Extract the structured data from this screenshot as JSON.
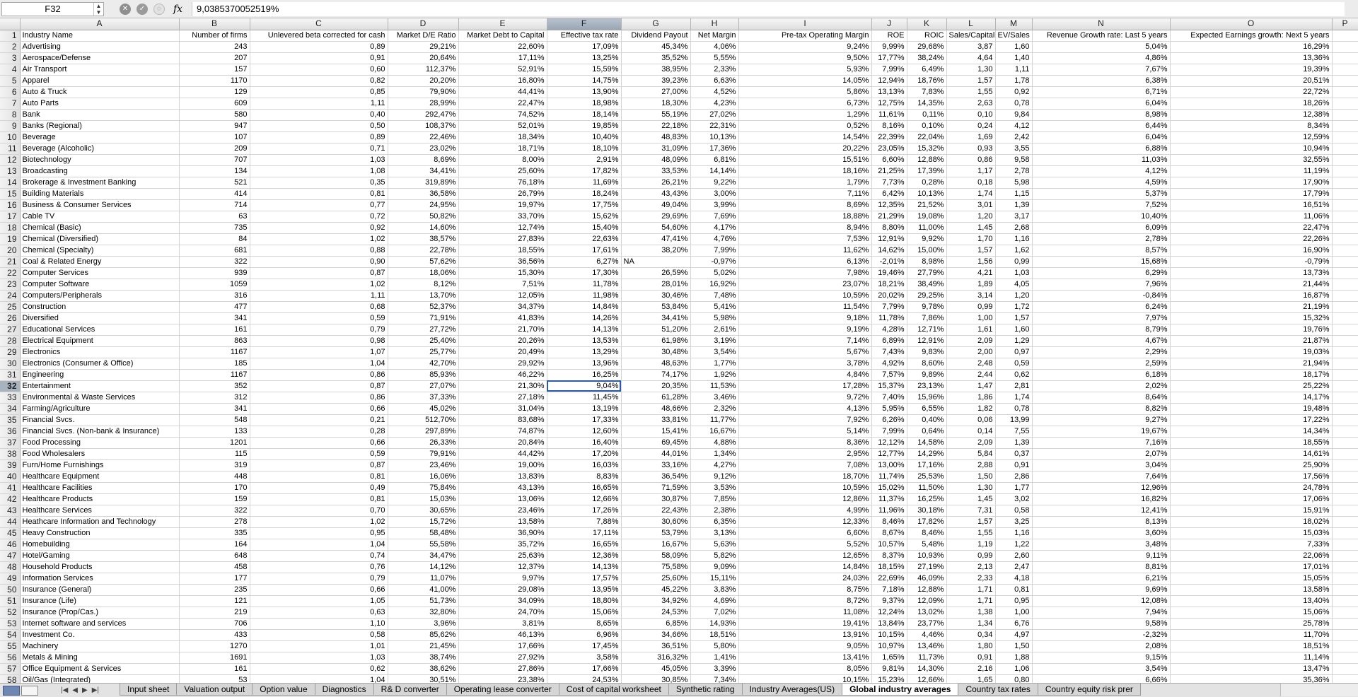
{
  "formula_bar": {
    "name_box": "F32",
    "formula": "9,0385370052519%"
  },
  "columns": [
    "A",
    "B",
    "C",
    "D",
    "E",
    "F",
    "G",
    "H",
    "I",
    "J",
    "K",
    "L",
    "M",
    "N",
    "O",
    "P"
  ],
  "selected_column": "F",
  "selected_row": 32,
  "header_row": [
    "Industry Name",
    "Number of firms",
    "Unlevered beta corrected for cash",
    "Market D/E Ratio",
    "Market Debt to Capital",
    "Effective tax rate",
    "Dividend Payout",
    "Net Margin",
    "Pre-tax Operating Margin",
    "ROE",
    "ROIC",
    "Sales/Capital",
    "EV/Sales",
    "Revenue Growth rate: Last 5 years",
    "Expected Earnings growth: Next 5 years",
    ""
  ],
  "rows": [
    [
      "Advertising",
      "243",
      "0,89",
      "29,21%",
      "22,60%",
      "17,09%",
      "45,34%",
      "4,06%",
      "9,24%",
      "9,99%",
      "29,68%",
      "3,87",
      "1,60",
      "5,04%",
      "16,29%"
    ],
    [
      "Aerospace/Defense",
      "207",
      "0,91",
      "20,64%",
      "17,11%",
      "13,25%",
      "35,52%",
      "5,55%",
      "9,50%",
      "17,77%",
      "38,24%",
      "4,64",
      "1,40",
      "4,86%",
      "13,36%"
    ],
    [
      "Air Transport",
      "157",
      "0,60",
      "112,37%",
      "52,91%",
      "15,59%",
      "38,95%",
      "2,33%",
      "5,93%",
      "7,99%",
      "6,49%",
      "1,30",
      "1,11",
      "7,67%",
      "19,39%"
    ],
    [
      "Apparel",
      "1170",
      "0,82",
      "20,20%",
      "16,80%",
      "14,75%",
      "39,23%",
      "6,63%",
      "14,05%",
      "12,94%",
      "18,76%",
      "1,57",
      "1,78",
      "6,38%",
      "20,51%"
    ],
    [
      "Auto & Truck",
      "129",
      "0,85",
      "79,90%",
      "44,41%",
      "13,90%",
      "27,00%",
      "4,52%",
      "5,86%",
      "13,13%",
      "7,83%",
      "1,55",
      "0,92",
      "6,71%",
      "22,72%"
    ],
    [
      "Auto Parts",
      "609",
      "1,11",
      "28,99%",
      "22,47%",
      "18,98%",
      "18,30%",
      "4,23%",
      "6,73%",
      "12,75%",
      "14,35%",
      "2,63",
      "0,78",
      "6,04%",
      "18,26%"
    ],
    [
      "Bank",
      "580",
      "0,40",
      "292,47%",
      "74,52%",
      "18,14%",
      "55,19%",
      "27,02%",
      "1,29%",
      "11,61%",
      "0,11%",
      "0,10",
      "9,84",
      "8,98%",
      "12,38%"
    ],
    [
      "Banks (Regional)",
      "947",
      "0,50",
      "108,37%",
      "52,01%",
      "19,85%",
      "22,18%",
      "22,31%",
      "0,52%",
      "8,16%",
      "0,10%",
      "0,24",
      "4,12",
      "6,44%",
      "8,34%"
    ],
    [
      "Beverage",
      "107",
      "0,89",
      "22,46%",
      "18,34%",
      "10,40%",
      "48,83%",
      "10,13%",
      "14,54%",
      "22,39%",
      "22,04%",
      "1,69",
      "2,42",
      "6,04%",
      "12,59%"
    ],
    [
      "Beverage (Alcoholic)",
      "209",
      "0,71",
      "23,02%",
      "18,71%",
      "18,10%",
      "31,09%",
      "17,36%",
      "20,22%",
      "23,05%",
      "15,32%",
      "0,93",
      "3,55",
      "6,88%",
      "10,94%"
    ],
    [
      "Biotechnology",
      "707",
      "1,03",
      "8,69%",
      "8,00%",
      "2,91%",
      "48,09%",
      "6,81%",
      "15,51%",
      "6,60%",
      "12,88%",
      "0,86",
      "9,58",
      "11,03%",
      "32,55%"
    ],
    [
      "Broadcasting",
      "134",
      "1,08",
      "34,41%",
      "25,60%",
      "17,82%",
      "33,53%",
      "14,14%",
      "18,16%",
      "21,25%",
      "17,39%",
      "1,17",
      "2,78",
      "4,12%",
      "11,19%"
    ],
    [
      "Brokerage & Investment Banking",
      "521",
      "0,35",
      "319,89%",
      "76,18%",
      "11,69%",
      "26,21%",
      "9,22%",
      "1,79%",
      "7,73%",
      "0,28%",
      "0,18",
      "5,98",
      "4,59%",
      "17,90%"
    ],
    [
      "Building Materials",
      "414",
      "0,81",
      "36,58%",
      "26,79%",
      "18,24%",
      "43,43%",
      "3,00%",
      "7,11%",
      "6,42%",
      "10,13%",
      "1,74",
      "1,15",
      "5,37%",
      "17,79%"
    ],
    [
      "Business & Consumer Services",
      "714",
      "0,77",
      "24,95%",
      "19,97%",
      "17,75%",
      "49,04%",
      "3,99%",
      "8,69%",
      "12,35%",
      "21,52%",
      "3,01",
      "1,39",
      "7,52%",
      "16,51%"
    ],
    [
      "Cable TV",
      "63",
      "0,72",
      "50,82%",
      "33,70%",
      "15,62%",
      "29,69%",
      "7,69%",
      "18,88%",
      "21,29%",
      "19,08%",
      "1,20",
      "3,17",
      "10,40%",
      "11,06%"
    ],
    [
      "Chemical (Basic)",
      "735",
      "0,92",
      "14,60%",
      "12,74%",
      "15,40%",
      "54,60%",
      "4,17%",
      "8,94%",
      "8,80%",
      "11,00%",
      "1,45",
      "2,68",
      "6,09%",
      "22,47%"
    ],
    [
      "Chemical (Diversified)",
      "84",
      "1,02",
      "38,57%",
      "27,83%",
      "22,63%",
      "47,41%",
      "4,76%",
      "7,53%",
      "12,91%",
      "9,92%",
      "1,70",
      "1,16",
      "2,78%",
      "22,26%"
    ],
    [
      "Chemical (Specialty)",
      "681",
      "0,88",
      "22,78%",
      "18,55%",
      "17,61%",
      "38,20%",
      "7,99%",
      "11,62%",
      "14,62%",
      "15,00%",
      "1,57",
      "1,62",
      "8,57%",
      "16,90%"
    ],
    [
      "Coal & Related Energy",
      "322",
      "0,90",
      "57,62%",
      "36,56%",
      "6,27%",
      "NA",
      "-0,97%",
      "6,13%",
      "-2,01%",
      "8,98%",
      "1,56",
      "0,99",
      "15,68%",
      "-0,79%"
    ],
    [
      "Computer Services",
      "939",
      "0,87",
      "18,06%",
      "15,30%",
      "17,30%",
      "26,59%",
      "5,02%",
      "7,98%",
      "19,46%",
      "27,79%",
      "4,21",
      "1,03",
      "6,29%",
      "13,73%"
    ],
    [
      "Computer Software",
      "1059",
      "1,02",
      "8,12%",
      "7,51%",
      "11,78%",
      "28,01%",
      "16,92%",
      "23,07%",
      "18,21%",
      "38,49%",
      "1,89",
      "4,05",
      "7,96%",
      "21,44%"
    ],
    [
      "Computers/Peripherals",
      "316",
      "1,11",
      "13,70%",
      "12,05%",
      "11,98%",
      "30,46%",
      "7,48%",
      "10,59%",
      "20,02%",
      "29,25%",
      "3,14",
      "1,20",
      "-0,84%",
      "16,87%"
    ],
    [
      "Construction",
      "477",
      "0,68",
      "52,37%",
      "34,37%",
      "14,84%",
      "53,84%",
      "5,41%",
      "11,54%",
      "7,79%",
      "9,78%",
      "0,99",
      "1,72",
      "6,24%",
      "21,19%"
    ],
    [
      "Diversified",
      "341",
      "0,59",
      "71,91%",
      "41,83%",
      "14,26%",
      "34,41%",
      "5,98%",
      "9,18%",
      "11,78%",
      "7,86%",
      "1,00",
      "1,57",
      "7,97%",
      "15,32%"
    ],
    [
      "Educational Services",
      "161",
      "0,79",
      "27,72%",
      "21,70%",
      "14,13%",
      "51,20%",
      "2,61%",
      "9,19%",
      "4,28%",
      "12,71%",
      "1,61",
      "1,60",
      "8,79%",
      "19,76%"
    ],
    [
      "Electrical Equipment",
      "863",
      "0,98",
      "25,40%",
      "20,26%",
      "13,53%",
      "61,98%",
      "3,19%",
      "7,14%",
      "6,89%",
      "12,91%",
      "2,09",
      "1,29",
      "4,67%",
      "21,87%"
    ],
    [
      "Electronics",
      "1167",
      "1,07",
      "25,77%",
      "20,49%",
      "13,29%",
      "30,48%",
      "3,54%",
      "5,67%",
      "7,43%",
      "9,83%",
      "2,00",
      "0,97",
      "2,29%",
      "19,03%"
    ],
    [
      "Electronics (Consumer & Office)",
      "185",
      "1,04",
      "42,70%",
      "29,92%",
      "13,96%",
      "48,63%",
      "1,77%",
      "3,78%",
      "4,92%",
      "8,60%",
      "2,48",
      "0,59",
      "2,59%",
      "21,94%"
    ],
    [
      "Engineering",
      "1167",
      "0,86",
      "85,93%",
      "46,22%",
      "16,25%",
      "74,17%",
      "1,92%",
      "4,84%",
      "7,57%",
      "9,89%",
      "2,44",
      "0,62",
      "6,18%",
      "18,17%"
    ],
    [
      "Entertainment",
      "352",
      "0,87",
      "27,07%",
      "21,30%",
      "9,04%",
      "20,35%",
      "11,53%",
      "17,28%",
      "15,37%",
      "23,13%",
      "1,47",
      "2,81",
      "2,02%",
      "25,22%"
    ],
    [
      "Environmental & Waste Services",
      "312",
      "0,86",
      "37,33%",
      "27,18%",
      "11,45%",
      "61,28%",
      "3,46%",
      "9,72%",
      "7,40%",
      "15,96%",
      "1,86",
      "1,74",
      "8,64%",
      "14,17%"
    ],
    [
      "Farming/Agriculture",
      "341",
      "0,66",
      "45,02%",
      "31,04%",
      "13,19%",
      "48,66%",
      "2,32%",
      "4,13%",
      "5,95%",
      "6,55%",
      "1,82",
      "0,78",
      "8,82%",
      "19,48%"
    ],
    [
      "Financial Svcs.",
      "548",
      "0,21",
      "512,70%",
      "83,68%",
      "17,33%",
      "33,81%",
      "11,77%",
      "7,92%",
      "6,26%",
      "0,40%",
      "0,06",
      "13,99",
      "9,27%",
      "17,22%"
    ],
    [
      "Financial Svcs. (Non-bank & Insurance)",
      "133",
      "0,28",
      "297,89%",
      "74,87%",
      "12,60%",
      "15,41%",
      "16,67%",
      "5,14%",
      "7,99%",
      "0,64%",
      "0,14",
      "7,55",
      "19,67%",
      "14,34%"
    ],
    [
      "Food Processing",
      "1201",
      "0,66",
      "26,33%",
      "20,84%",
      "16,40%",
      "69,45%",
      "4,88%",
      "8,36%",
      "12,12%",
      "14,58%",
      "2,09",
      "1,39",
      "7,16%",
      "18,55%"
    ],
    [
      "Food Wholesalers",
      "115",
      "0,59",
      "79,91%",
      "44,42%",
      "17,20%",
      "44,01%",
      "1,34%",
      "2,95%",
      "12,77%",
      "14,29%",
      "5,84",
      "0,37",
      "2,07%",
      "14,61%"
    ],
    [
      "Furn/Home Furnishings",
      "319",
      "0,87",
      "23,46%",
      "19,00%",
      "16,03%",
      "33,16%",
      "4,27%",
      "7,08%",
      "13,00%",
      "17,16%",
      "2,88",
      "0,91",
      "3,04%",
      "25,90%"
    ],
    [
      "Healthcare Equipment",
      "448",
      "0,81",
      "16,06%",
      "13,83%",
      "8,83%",
      "36,54%",
      "9,12%",
      "18,70%",
      "11,74%",
      "25,53%",
      "1,50",
      "2,86",
      "7,64%",
      "17,56%"
    ],
    [
      "Healthcare Facilities",
      "170",
      "0,49",
      "75,84%",
      "43,13%",
      "16,65%",
      "71,59%",
      "3,53%",
      "10,59%",
      "15,02%",
      "11,50%",
      "1,30",
      "1,77",
      "12,96%",
      "24,78%"
    ],
    [
      "Healthcare Products",
      "159",
      "0,81",
      "15,03%",
      "13,06%",
      "12,66%",
      "30,87%",
      "7,85%",
      "12,86%",
      "11,37%",
      "16,25%",
      "1,45",
      "3,02",
      "16,82%",
      "17,06%"
    ],
    [
      "Healthcare Services",
      "322",
      "0,70",
      "30,65%",
      "23,46%",
      "17,26%",
      "22,43%",
      "2,38%",
      "4,99%",
      "11,96%",
      "30,18%",
      "7,31",
      "0,58",
      "12,41%",
      "15,91%"
    ],
    [
      "Heathcare Information and Technology",
      "278",
      "1,02",
      "15,72%",
      "13,58%",
      "7,88%",
      "30,60%",
      "6,35%",
      "12,33%",
      "8,46%",
      "17,82%",
      "1,57",
      "3,25",
      "8,13%",
      "18,02%"
    ],
    [
      "Heavy Construction",
      "335",
      "0,95",
      "58,48%",
      "36,90%",
      "17,11%",
      "53,79%",
      "3,13%",
      "6,60%",
      "8,67%",
      "8,46%",
      "1,55",
      "1,16",
      "3,60%",
      "15,03%"
    ],
    [
      "Homebuilding",
      "164",
      "1,04",
      "55,58%",
      "35,72%",
      "16,65%",
      "16,67%",
      "5,63%",
      "5,52%",
      "10,57%",
      "5,48%",
      "1,19",
      "1,22",
      "3,48%",
      "7,33%"
    ],
    [
      "Hotel/Gaming",
      "648",
      "0,74",
      "34,47%",
      "25,63%",
      "12,36%",
      "58,09%",
      "5,82%",
      "12,65%",
      "8,37%",
      "10,93%",
      "0,99",
      "2,60",
      "9,11%",
      "22,06%"
    ],
    [
      "Household Products",
      "458",
      "0,76",
      "14,12%",
      "12,37%",
      "14,13%",
      "75,58%",
      "9,09%",
      "14,84%",
      "18,15%",
      "27,19%",
      "2,13",
      "2,47",
      "8,81%",
      "17,01%"
    ],
    [
      "Information Services",
      "177",
      "0,79",
      "11,07%",
      "9,97%",
      "17,57%",
      "25,60%",
      "15,11%",
      "24,03%",
      "22,69%",
      "46,09%",
      "2,33",
      "4,18",
      "6,21%",
      "15,05%"
    ],
    [
      "Insurance (General)",
      "235",
      "0,66",
      "41,00%",
      "29,08%",
      "13,95%",
      "45,22%",
      "3,83%",
      "8,75%",
      "7,18%",
      "12,88%",
      "1,71",
      "0,81",
      "9,69%",
      "13,58%"
    ],
    [
      "Insurance (Life)",
      "121",
      "1,05",
      "51,73%",
      "34,09%",
      "18,80%",
      "34,92%",
      "4,69%",
      "8,72%",
      "9,37%",
      "12,09%",
      "1,71",
      "0,95",
      "12,08%",
      "13,40%"
    ],
    [
      "Insurance (Prop/Cas.)",
      "219",
      "0,63",
      "32,80%",
      "24,70%",
      "15,06%",
      "24,53%",
      "7,02%",
      "11,08%",
      "12,24%",
      "13,02%",
      "1,38",
      "1,00",
      "7,94%",
      "15,06%"
    ],
    [
      "Internet software and services",
      "706",
      "1,10",
      "3,96%",
      "3,81%",
      "8,65%",
      "6,85%",
      "14,93%",
      "19,41%",
      "13,84%",
      "23,77%",
      "1,34",
      "6,76",
      "9,58%",
      "25,78%"
    ],
    [
      "Investment Co.",
      "433",
      "0,58",
      "85,62%",
      "46,13%",
      "6,96%",
      "34,66%",
      "18,51%",
      "13,91%",
      "10,15%",
      "4,46%",
      "0,34",
      "4,97",
      "-2,32%",
      "11,70%"
    ],
    [
      "Machinery",
      "1270",
      "1,01",
      "21,45%",
      "17,66%",
      "17,45%",
      "36,51%",
      "5,80%",
      "9,05%",
      "10,97%",
      "13,46%",
      "1,80",
      "1,50",
      "2,08%",
      "18,51%"
    ],
    [
      "Metals & Mining",
      "1691",
      "1,03",
      "38,74%",
      "27,92%",
      "3,58%",
      "316,32%",
      "1,41%",
      "13,41%",
      "1,65%",
      "11,73%",
      "0,91",
      "1,88",
      "9,15%",
      "11,14%"
    ],
    [
      "Office Equipment & Services",
      "161",
      "0,62",
      "38,62%",
      "27,86%",
      "17,66%",
      "45,05%",
      "3,39%",
      "8,05%",
      "9,81%",
      "14,30%",
      "2,16",
      "1,06",
      "3,54%",
      "13,47%"
    ],
    [
      "Oil/Gas (Integrated)",
      "53",
      "1,04",
      "30,51%",
      "23,38%",
      "24,53%",
      "30,85%",
      "7,34%",
      "10,15%",
      "15,23%",
      "12,66%",
      "1,65",
      "0,80",
      "6,66%",
      "35,36%"
    ]
  ],
  "sheet_tabs": [
    "Input sheet",
    "Valuation output",
    "Option value",
    "Diagnostics",
    "R& D converter",
    "Operating lease converter",
    "Cost of capital worksheet",
    "Synthetic rating",
    "Industry Averages(US)",
    "Global industry averages",
    "Country tax rates",
    "Country equity risk prer"
  ],
  "active_tab": "Global industry averages"
}
